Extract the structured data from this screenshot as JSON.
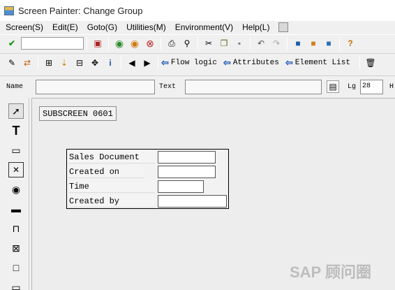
{
  "window": {
    "title": "Screen Painter: Change Group"
  },
  "menu": [
    "Screen(S)",
    "Edit(E)",
    "Goto(G)",
    "Utilities(M)",
    "Environment(V)",
    "Help(L)"
  ],
  "toolbar2": {
    "flow_logic": "Flow logic",
    "attributes": "Attributes",
    "element_list": "Element List"
  },
  "fields": {
    "name_label": "Name",
    "text_label": "Text",
    "lg_label": "Lg",
    "lg_value": "28",
    "h_label": "H"
  },
  "canvas": {
    "subscreen_label": "SUBSCREEN 0601",
    "rows": [
      {
        "label": "Sales Document"
      },
      {
        "label": "Created on"
      },
      {
        "label": "Time"
      },
      {
        "label": "Created by"
      }
    ]
  },
  "watermark": "SAP 顾问圈"
}
